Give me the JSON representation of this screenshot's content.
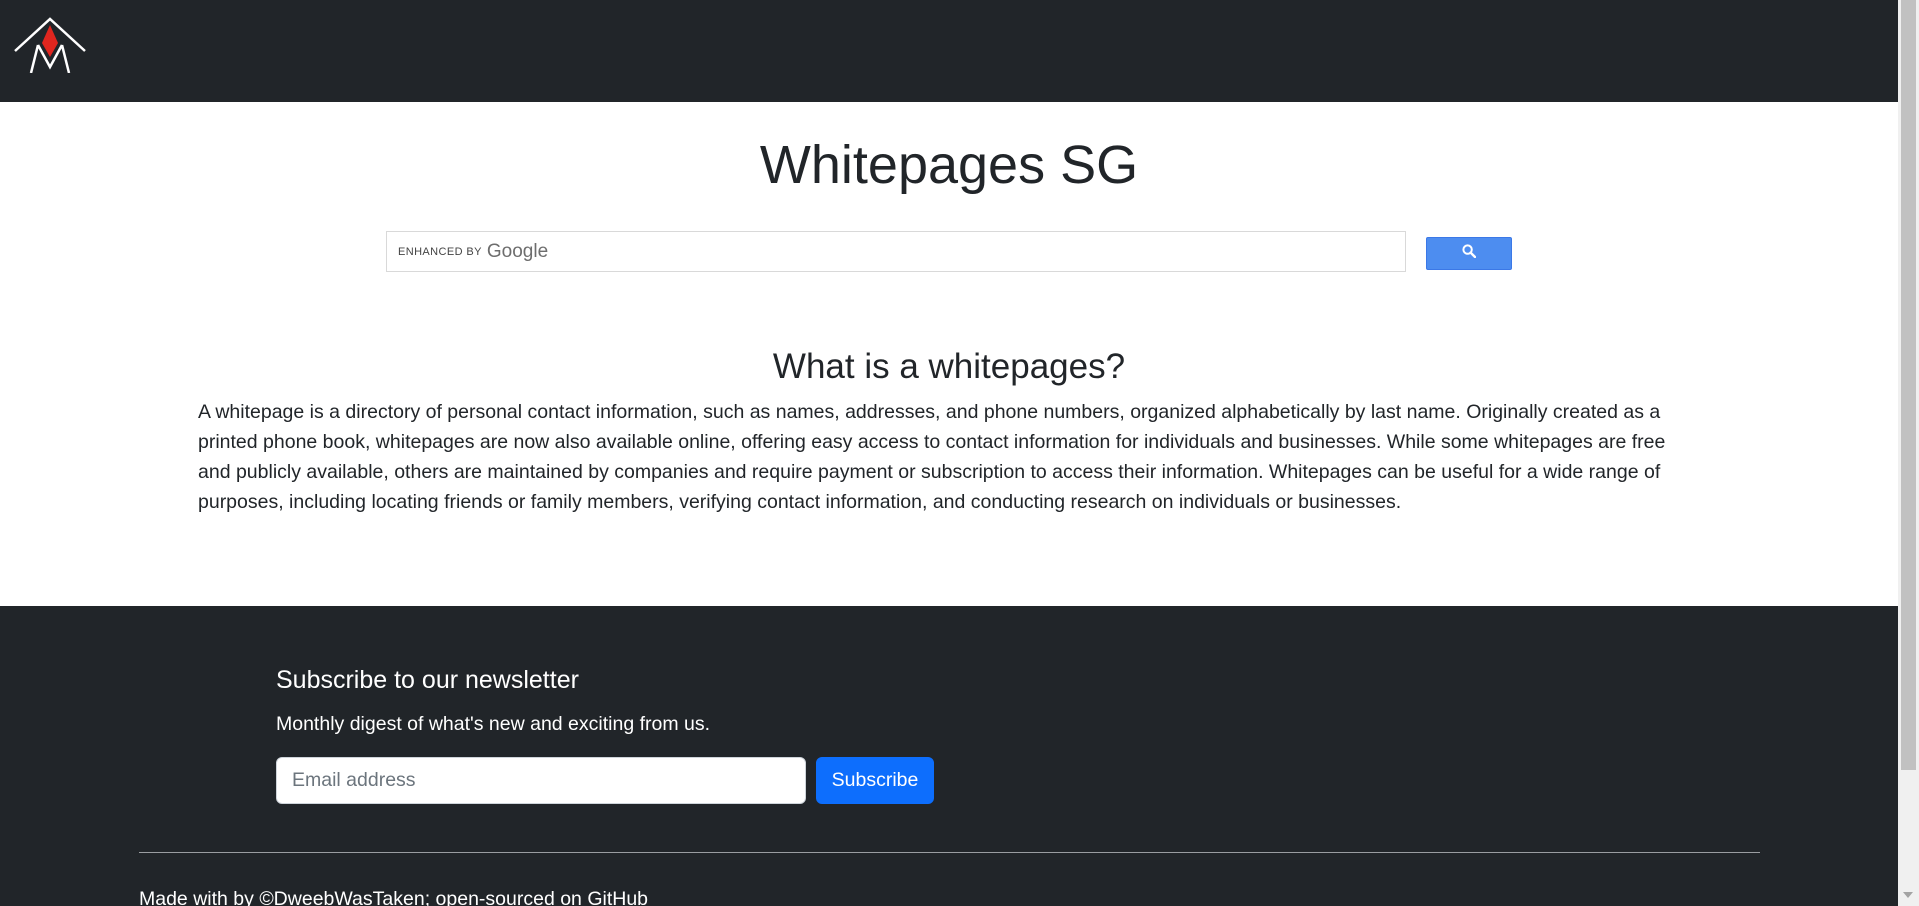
{
  "navbar": {
    "logo_icon": "mountain-logo-icon"
  },
  "header": {
    "title": "Whitepages SG"
  },
  "search": {
    "watermark_prefix": "ENHANCED BY",
    "watermark_brand": "Google",
    "button_icon": "search-icon"
  },
  "about": {
    "heading": "What is a whitepages?",
    "body": "A whitepage is a directory of personal contact information, such as names, addresses, and phone numbers, organized alphabetically by last name. Originally created as a printed phone book, whitepages are now also available online, offering easy access to contact information for individuals and businesses. While some whitepages are free and publicly available, others are maintained by companies and require payment or subscription to access their information. Whitepages can be useful for a wide range of purposes, including locating friends or family members, verifying contact information, and conducting research on individuals or businesses."
  },
  "newsletter": {
    "heading": "Subscribe to our newsletter",
    "subtext": "Monthly digest of what's new and exciting from us.",
    "email_placeholder": "Email address",
    "button_label": "Subscribe"
  },
  "footer": {
    "credit_prefix": "Made with by ",
    "author_link": "©DweebWasTaken",
    "credit_middle": "; open-sourced on ",
    "github_link": "GitHub"
  },
  "colors": {
    "dark": "#212529",
    "primary": "#0d6efd",
    "google_button": "#4d8df0",
    "logo_accent": "#e0261f"
  }
}
